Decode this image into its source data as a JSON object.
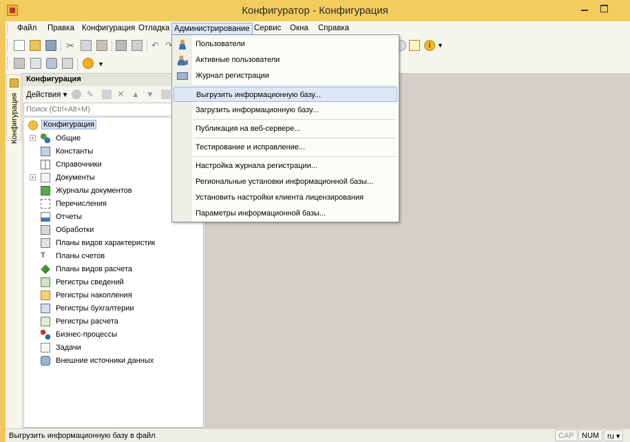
{
  "window": {
    "title": "Конфигуратор - Конфигурация",
    "accent_color": "#f3cc5e"
  },
  "menubar": {
    "items": [
      "Файл",
      "Правка",
      "Конфигурация",
      "Отладка",
      "Администрирование",
      "Сервис",
      "Окна",
      "Справка"
    ],
    "active_item": "Администрирование"
  },
  "side_tab": {
    "label": "Конфигурация",
    "icon": "configuration-icon"
  },
  "panel": {
    "header": "Конфигурация",
    "actions_label": "Действия ▾",
    "search_placeholder": "Поиск (Ctrl+Alt+M)",
    "tree": [
      {
        "label": "Конфигурация",
        "icon": "configuration-root-icon"
      },
      {
        "label": "Общие",
        "icon": "common-icon"
      },
      {
        "label": "Константы",
        "icon": "constants-icon"
      },
      {
        "label": "Справочники",
        "icon": "catalogs-icon"
      },
      {
        "label": "Документы",
        "icon": "documents-icon"
      },
      {
        "label": "Журналы документов",
        "icon": "document-journals-icon"
      },
      {
        "label": "Перечисления",
        "icon": "enumerations-icon"
      },
      {
        "label": "Отчеты",
        "icon": "reports-icon"
      },
      {
        "label": "Обработки",
        "icon": "data-processors-icon"
      },
      {
        "label": "Планы видов характеристик",
        "icon": "characteristic-types-icon"
      },
      {
        "label": "Планы счетов",
        "icon": "charts-of-accounts-icon"
      },
      {
        "label": "Планы видов расчета",
        "icon": "calculation-types-icon"
      },
      {
        "label": "Регистры сведений",
        "icon": "information-registers-icon"
      },
      {
        "label": "Регистры накопления",
        "icon": "accumulation-registers-icon"
      },
      {
        "label": "Регистры бухгалтерии",
        "icon": "accounting-registers-icon"
      },
      {
        "label": "Регистры расчета",
        "icon": "calculation-registers-icon"
      },
      {
        "label": "Бизнес-процессы",
        "icon": "business-processes-icon"
      },
      {
        "label": "Задачи",
        "icon": "tasks-icon"
      },
      {
        "label": "Внешние источники данных",
        "icon": "external-data-sources-icon"
      }
    ]
  },
  "dropdown": {
    "items": [
      {
        "label": "Пользователи",
        "icon": "user-icon"
      },
      {
        "label": "Активные пользователи",
        "icon": "active-users-icon"
      },
      {
        "label": "Журнал регистрации",
        "icon": "event-log-icon"
      },
      {
        "label": "Выгрузить информационную базу...",
        "icon": ""
      },
      {
        "label": "Загрузить информационную базу...",
        "icon": ""
      },
      {
        "label": "Публикация на веб-сервере...",
        "icon": ""
      },
      {
        "label": "Тестирование и исправление...",
        "icon": ""
      },
      {
        "label": "Настройка журнала регистрации...",
        "icon": ""
      },
      {
        "label": "Региональные установки информационной базы...",
        "icon": ""
      },
      {
        "label": "Установить настройки клиента лицензирования",
        "icon": ""
      },
      {
        "label": "Параметры информационной базы...",
        "icon": ""
      }
    ],
    "highlighted": "Выгрузить информационную базу..."
  },
  "statusbar": {
    "text": "Выгрузить информационную базу в файл",
    "cap": "CAP",
    "num": "NUM",
    "lang": "ru ▾"
  }
}
